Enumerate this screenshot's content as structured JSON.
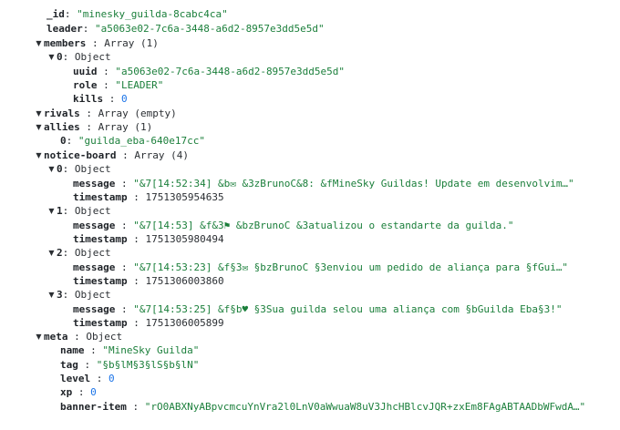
{
  "doc": {
    "id_key": "_id",
    "id_val": "\"minesky_guilda-8cabc4ca\"",
    "leader_key": "leader",
    "leader_val": "\"a5063e02-7c6a-3448-a6d2-8957e3dd5e5d\"",
    "members_key": "members",
    "members_type": "Array (1)",
    "m0_key": "0",
    "m0_type": "Object",
    "m0_uuid_key": "uuid",
    "m0_uuid_val": "\"a5063e02-7c6a-3448-a6d2-8957e3dd5e5d\"",
    "m0_role_key": "role",
    "m0_role_val": "\"LEADER\"",
    "m0_kills_key": "kills",
    "m0_kills_val": "0",
    "rivals_key": "rivals",
    "rivals_type": "Array (empty)",
    "allies_key": "allies",
    "allies_type": "Array (1)",
    "a0_key": "0",
    "a0_val": "\"guilda_eba-640e17cc\"",
    "nb_key": "notice-board",
    "nb_type": "Array (4)",
    "nb0_key": "0",
    "nb0_type": "Object",
    "nb0_msg_key": "message",
    "nb0_msg_val": "\"&7[14:52:34] &b✉ &3zBrunoC&8: &fMineSky Guildas! Update em desenvolvim…\"",
    "nb0_ts_key": "timestamp",
    "nb0_ts_val": "1751305954635",
    "nb1_key": "1",
    "nb1_type": "Object",
    "nb1_msg_key": "message",
    "nb1_msg_val": "\"&7[14:53] &f&3⚑ &bzBrunoC &3atualizou o estandarte da guilda.\"",
    "nb1_ts_key": "timestamp",
    "nb1_ts_val": "1751305980494",
    "nb2_key": "2",
    "nb2_type": "Object",
    "nb2_msg_key": "message",
    "nb2_msg_val": "\"&7[14:53:23] &f§3✉ §bzBrunoC §3enviou um pedido de aliança para §fGui…\"",
    "nb2_ts_key": "timestamp",
    "nb2_ts_val": "1751306003860",
    "nb3_key": "3",
    "nb3_type": "Object",
    "nb3_msg_key": "message",
    "nb3_msg_val": "\"&7[14:53:25] &f§b♥ §3Sua guilda selou uma aliança com §bGuilda Eba§3!\"",
    "nb3_ts_key": "timestamp",
    "nb3_ts_val": "1751306005899",
    "meta_key": "meta",
    "meta_type": "Object",
    "meta_name_key": "name",
    "meta_name_val": "\"MineSky Guilda\"",
    "meta_tag_key": "tag",
    "meta_tag_val": "\"§b§lM§3§lS§b§lN\"",
    "meta_level_key": "level",
    "meta_level_val": "0",
    "meta_xp_key": "xp",
    "meta_xp_val": "0",
    "meta_banner_key": "banner-item",
    "meta_banner_val": "\"rO0ABXNyABpvcmcuYnVra2l0LnV0aWwuaW8uV3JhcHBlcvJQR+zxEm8FAgABTAADbWFwdA…\""
  },
  "colors": {
    "string": "#1b7f3b",
    "number": "#1a73e8",
    "key": "#1f2328"
  },
  "icons": {
    "expanded": "caret-down-icon"
  }
}
